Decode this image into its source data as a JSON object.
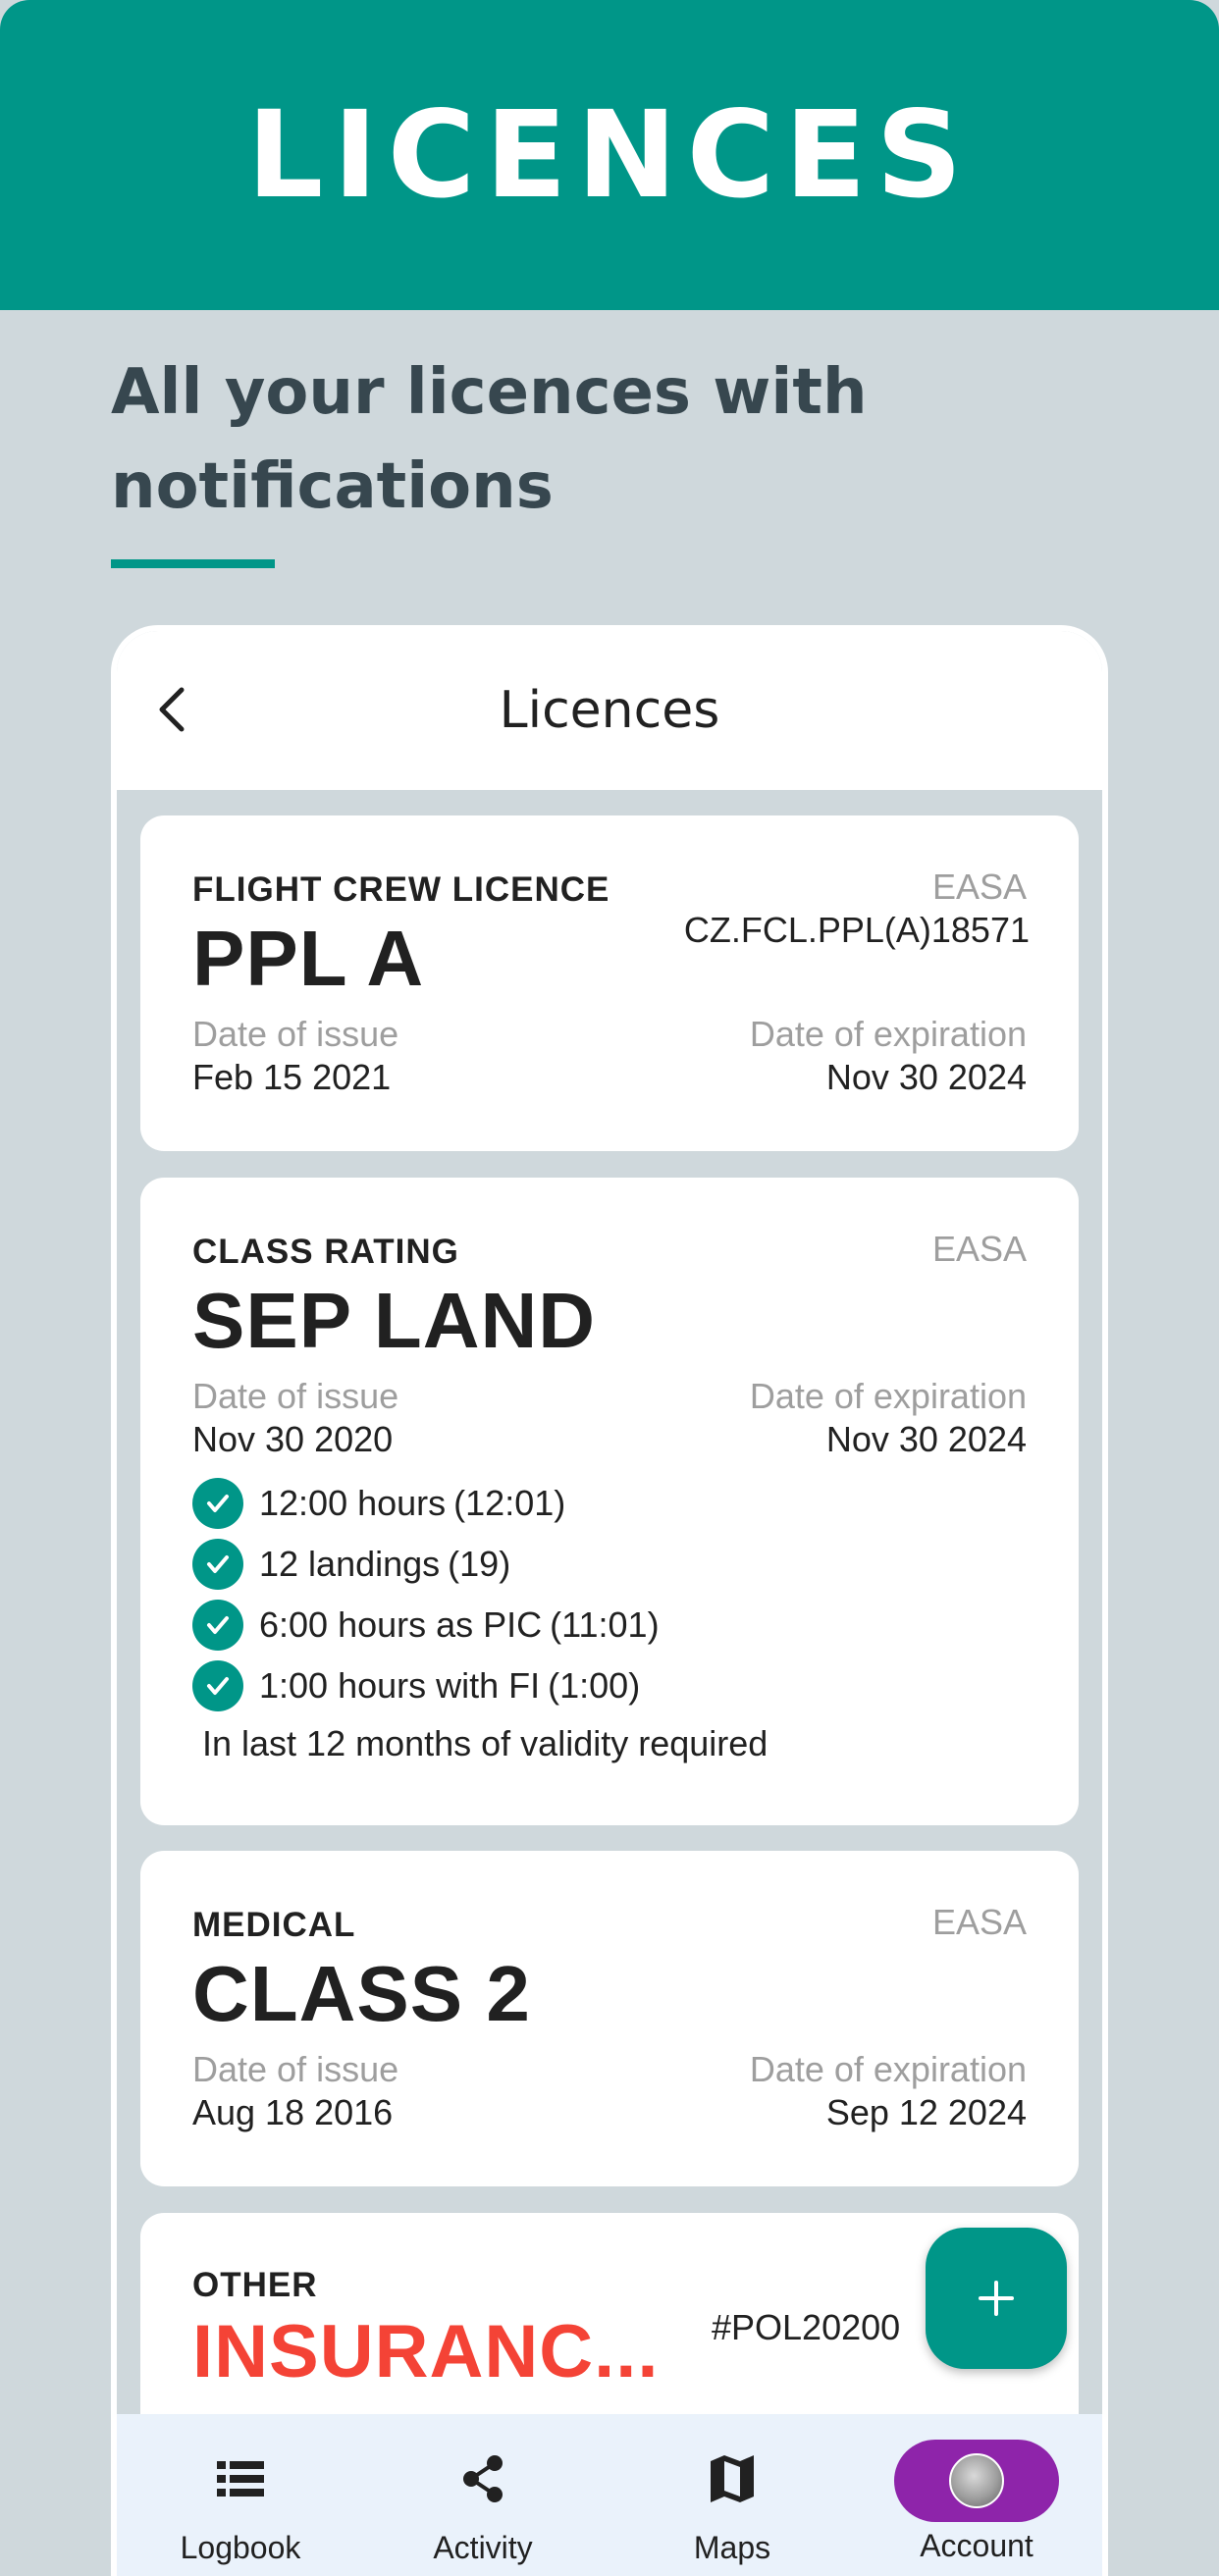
{
  "hero": {
    "title": "LICENCES"
  },
  "subtitle": "All your licences with notifications",
  "colors": {
    "primary": "#009688",
    "background": "#cfd8dc",
    "accent_red": "#f44336",
    "nav_active": "#8e24aa"
  },
  "screen": {
    "title": "Licences",
    "back_icon": "chevron-left-icon"
  },
  "licences": [
    {
      "category": "FLIGHT CREW LICENCE",
      "name": "PPL A",
      "authority": "EASA",
      "number": "CZ.FCL.PPL(A)18571",
      "issue_label": "Date of issue",
      "issue_date": "Feb 15 2021",
      "expiry_label": "Date of expiration",
      "expiry_date": "Nov 30 2024"
    },
    {
      "category": "CLASS RATING",
      "name": "SEP LAND",
      "authority": "EASA",
      "issue_label": "Date of issue",
      "issue_date": "Nov 30 2020",
      "expiry_label": "Date of expiration",
      "expiry_date": "Nov 30 2024",
      "requirements": [
        {
          "text": "12:00 hours",
          "actual": "(12:01)"
        },
        {
          "text": "12 landings",
          "actual": "(19)"
        },
        {
          "text": "6:00 hours as PIC",
          "actual": "(11:01)"
        },
        {
          "text": "1:00 hours with FI",
          "actual": "(1:00)"
        }
      ],
      "requirements_note": "In last 12 months of validity required"
    },
    {
      "category": "MEDICAL",
      "name": "CLASS 2",
      "authority": "EASA",
      "issue_label": "Date of issue",
      "issue_date": "Aug 18 2016",
      "expiry_label": "Date of expiration",
      "expiry_date": "Sep 12 2024"
    },
    {
      "category": "OTHER",
      "name": "INSURANC...",
      "number": "#POL20200"
    }
  ],
  "fab": {
    "icon": "plus-icon"
  },
  "nav": [
    {
      "label": "Logbook",
      "icon": "list-icon"
    },
    {
      "label": "Activity",
      "icon": "share-icon"
    },
    {
      "label": "Maps",
      "icon": "map-icon"
    },
    {
      "label": "Account",
      "icon": "avatar"
    }
  ]
}
